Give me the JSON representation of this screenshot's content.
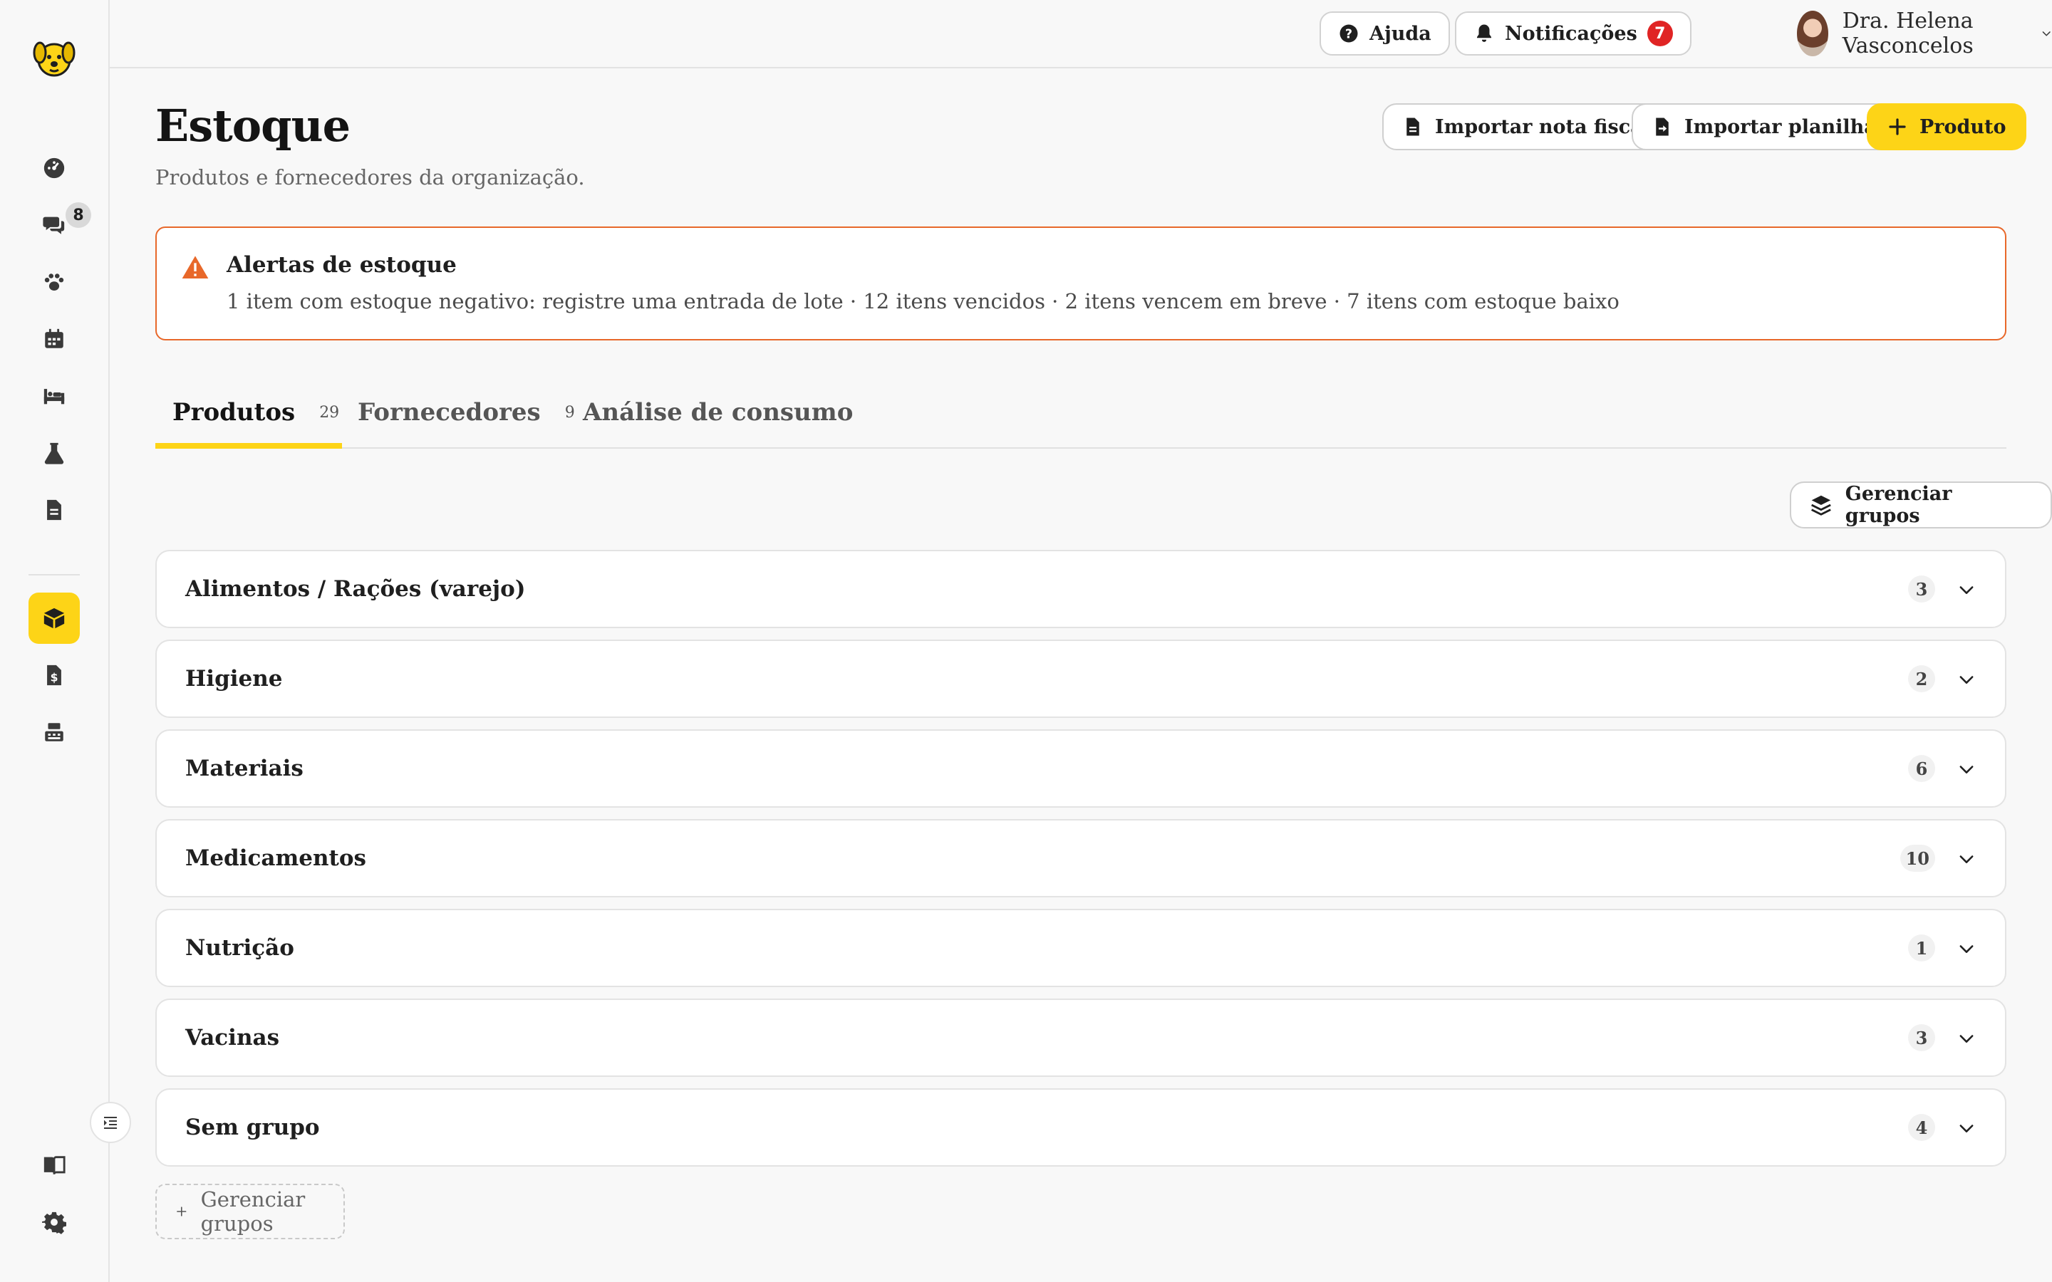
{
  "sidebar": {
    "logo_icon": "dog-logo-icon",
    "chat_badge": "8",
    "items": [
      {
        "icon": "dashboard-icon"
      },
      {
        "icon": "chat-icon"
      },
      {
        "icon": "paw-icon"
      },
      {
        "icon": "calendar-icon"
      },
      {
        "icon": "bed-icon"
      },
      {
        "icon": "flask-icon"
      },
      {
        "icon": "document-icon"
      },
      {
        "icon": "box-icon",
        "active": true
      },
      {
        "icon": "invoice-icon"
      },
      {
        "icon": "cash-register-icon"
      },
      {
        "icon": "book-icon"
      },
      {
        "icon": "gear-icon"
      }
    ]
  },
  "topbar": {
    "help_label": "Ajuda",
    "notifications_label": "Notificações",
    "notifications_count": "7",
    "user_name": "Dra. Helena Vasconcelos"
  },
  "header": {
    "title": "Estoque",
    "subtitle": "Produtos e fornecedores da organização.",
    "import_invoice_label": "Importar nota fiscal",
    "import_sheet_label": "Importar planilha",
    "add_product_label": "Produto"
  },
  "alert": {
    "title": "Alertas de estoque",
    "text": "1 item com estoque negativo: registre uma entrada de lote · 12 itens vencidos · 2 itens vencem em breve · 7 itens com estoque baixo"
  },
  "tabs": [
    {
      "label": "Produtos",
      "count": "29"
    },
    {
      "label": "Fornecedores",
      "count": "9"
    },
    {
      "label": "Análise de consumo",
      "count": ""
    }
  ],
  "manage_groups_label": "Gerenciar grupos",
  "groups": [
    {
      "name": "Alimentos / Rações (varejo)",
      "count": "3"
    },
    {
      "name": "Higiene",
      "count": "2"
    },
    {
      "name": "Materiais",
      "count": "6"
    },
    {
      "name": "Medicamentos",
      "count": "10"
    },
    {
      "name": "Nutrição",
      "count": "1"
    },
    {
      "name": "Vacinas",
      "count": "3"
    },
    {
      "name": "Sem grupo",
      "count": "4"
    }
  ],
  "manage_groups_bottom_label": "Gerenciar grupos",
  "colors": {
    "accent": "#fdd417",
    "alert_border": "#e8682a",
    "badge_red": "#e02424"
  }
}
